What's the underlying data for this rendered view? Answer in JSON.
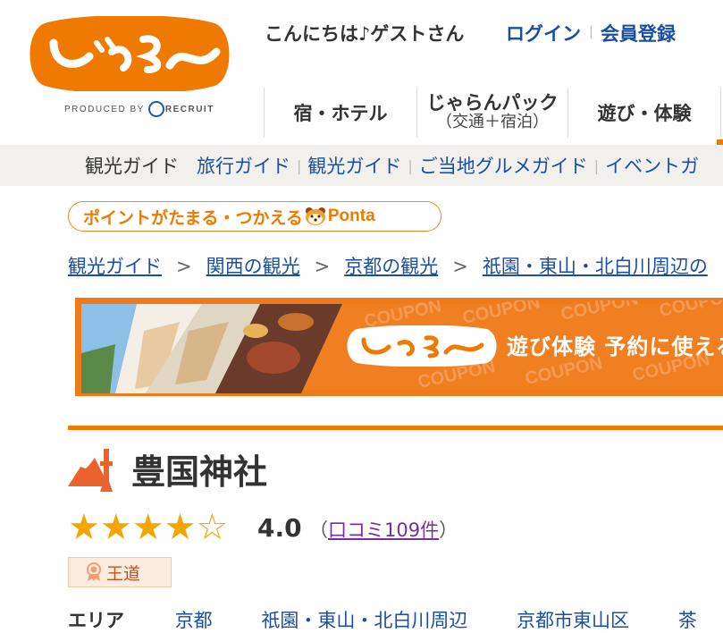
{
  "header": {
    "logo_text": "じゃらん",
    "produced_by": "PRODUCED BY",
    "recruit": "RECRUIT",
    "greeting": "こんにちは♪ゲストさん",
    "login": "ログイン",
    "register": "会員登録"
  },
  "main_nav": {
    "hotel": "宿・ホテル",
    "pack": "じゃらんパック",
    "pack_sub": "（交通＋宿泊）",
    "activity": "遊び・体験"
  },
  "sub_nav": {
    "current": "観光ガイド",
    "links": [
      "旅行ガイド",
      "観光ガイド",
      "ご当地グルメガイド",
      "イベントガ"
    ]
  },
  "ponta": {
    "text": "ポイントがたまる・つかえる",
    "brand": "Ponta"
  },
  "breadcrumb": [
    "観光ガイド",
    "関西の観光",
    "京都の観光",
    "祇園・東山・北白川周辺の"
  ],
  "banner": {
    "logo_text": "じゃらん",
    "slogan": "遊び体験 予約に使える",
    "watermark": "COUPON"
  },
  "spot": {
    "title": "豊国神社",
    "rating": 4.0,
    "score_text": "4.0",
    "reviews_open": "（",
    "reviews_link": "口コミ109件",
    "reviews_close": "）",
    "badge": "王道"
  },
  "area": {
    "label": "エリア",
    "values": [
      "京都",
      "祇園・東山・北白川周辺",
      "京都市東山区",
      "茶"
    ]
  },
  "colors": {
    "accent": "#f07a00",
    "link": "#1a4fa0",
    "star": "#f3a500",
    "visited": "#7b2c9e"
  }
}
